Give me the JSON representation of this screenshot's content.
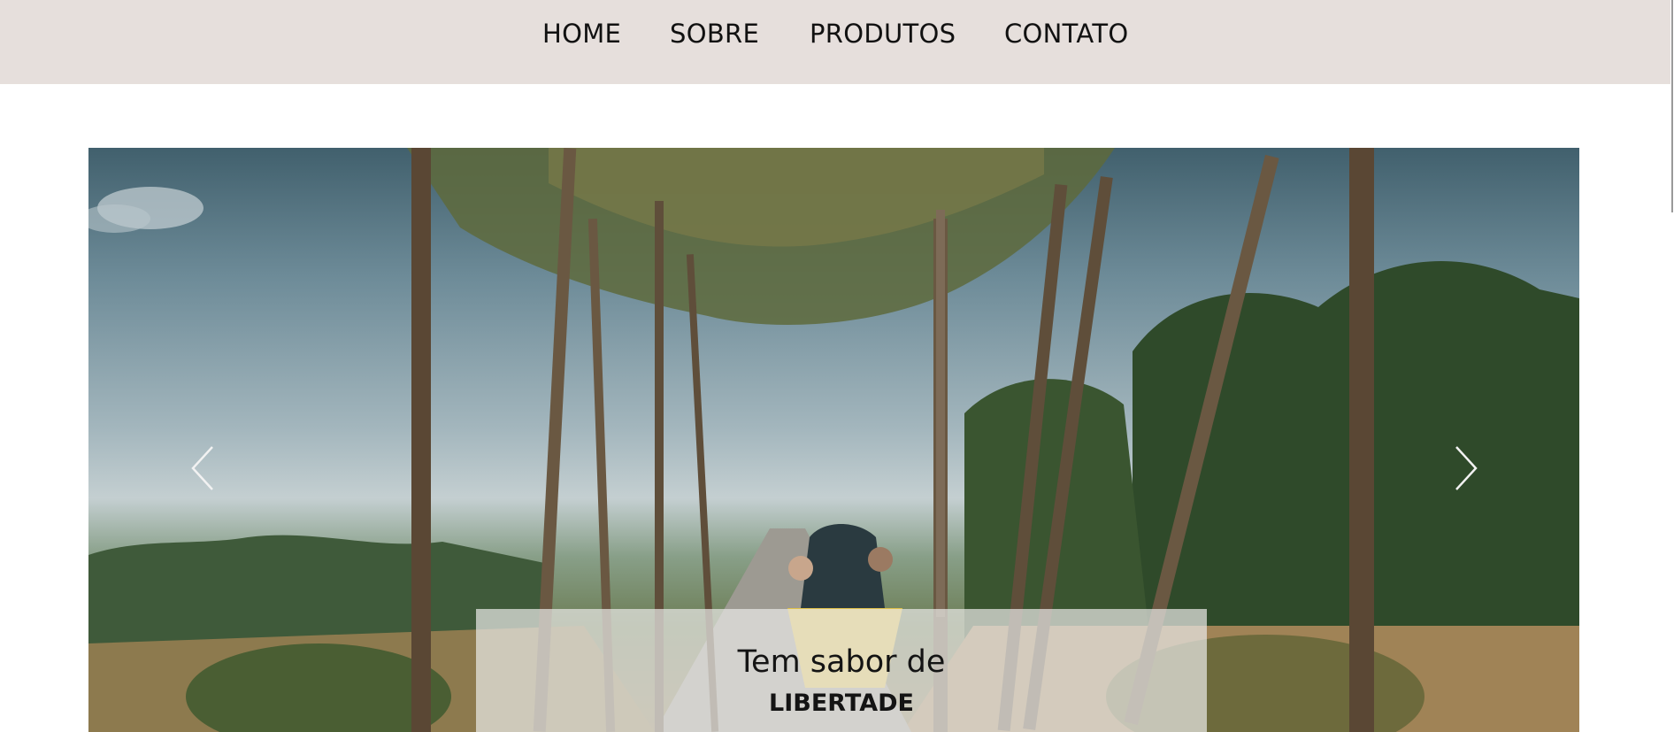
{
  "nav": {
    "items": [
      {
        "label": "HOME"
      },
      {
        "label": "SOBRE"
      },
      {
        "label": "PRODUTOS"
      },
      {
        "label": "CONTATO"
      }
    ]
  },
  "hero": {
    "image": "couple riding yellow scooter on palm-lined road",
    "prev_icon": "chevron-left-icon",
    "next_icon": "chevron-right-icon",
    "caption": {
      "title": "Tem sabor de",
      "subtitle": "LIBERTADE"
    }
  },
  "colors": {
    "nav_background": "#e6dfdc",
    "nav_text": "#111111",
    "caption_background": "rgba(232,232,228,0.72)"
  }
}
